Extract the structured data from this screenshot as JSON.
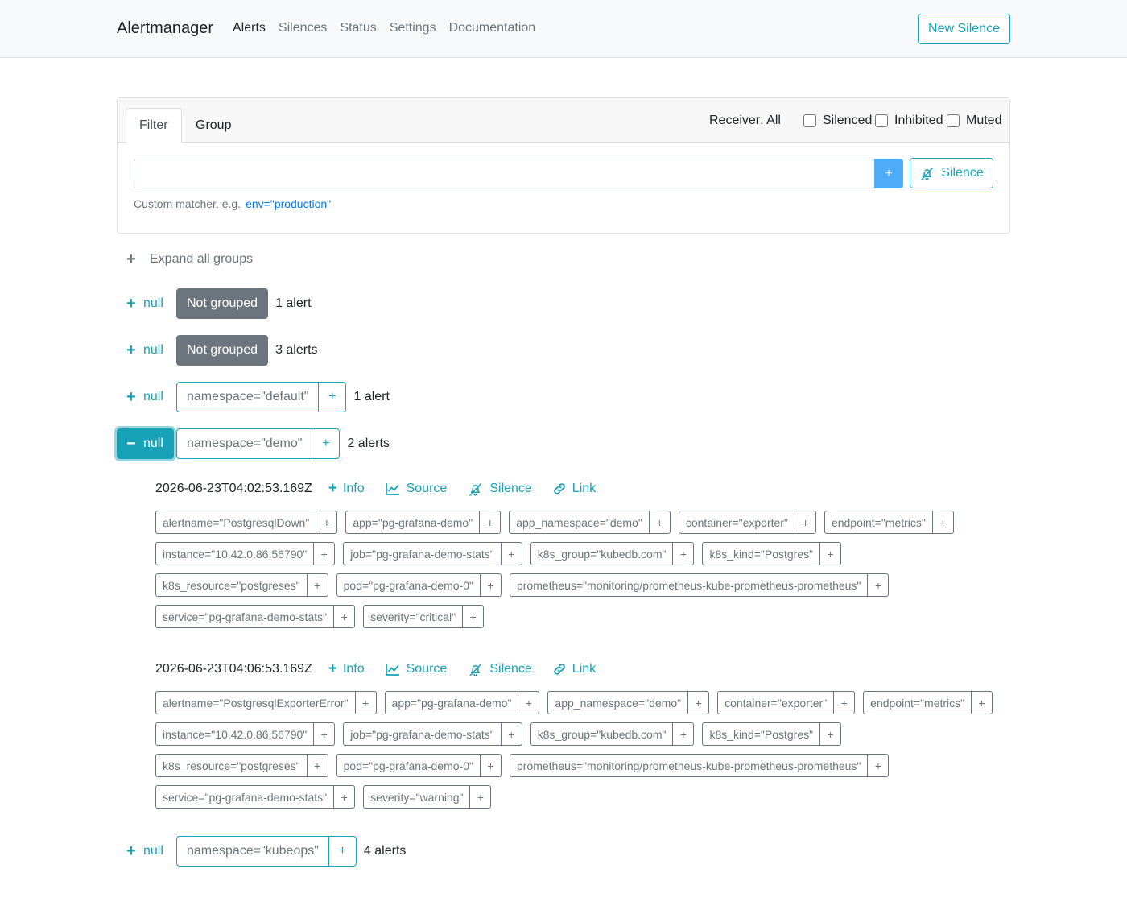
{
  "nav": {
    "brand": "Alertmanager",
    "links": [
      "Alerts",
      "Silences",
      "Status",
      "Settings",
      "Documentation"
    ],
    "new_silence": "New Silence"
  },
  "filter_card": {
    "tabs": [
      "Filter",
      "Group"
    ],
    "receiver": "Receiver: All",
    "checkboxes": [
      "Silenced",
      "Inhibited",
      "Muted"
    ],
    "input_value": "",
    "add_button": "+",
    "silence_button": "Silence",
    "hint": "Custom matcher, e.g.",
    "hint_example": "env=\"production\""
  },
  "expand_all": "Expand all groups",
  "groups": [
    {
      "toggle": "null",
      "symbol": "+",
      "badge": "Not grouped",
      "count": "1 alert"
    },
    {
      "toggle": "null",
      "symbol": "+",
      "badge": "Not grouped",
      "count": "3 alerts"
    },
    {
      "toggle": "null",
      "symbol": "+",
      "label": "namespace=\"default\"",
      "label_add": "+",
      "count": "1 alert"
    },
    {
      "toggle": "null",
      "symbol": "−",
      "label": "namespace=\"demo\"",
      "label_add": "+",
      "count": "2 alerts"
    },
    {
      "toggle": "null",
      "symbol": "+",
      "label": "namespace=\"kubeops\"",
      "label_add": "+",
      "count": "4 alerts"
    }
  ],
  "alert_actions": {
    "info": "Info",
    "source": "Source",
    "silence": "Silence",
    "link": "Link"
  },
  "alerts": [
    {
      "timestamp": "2026-06-23T04:02:53.169Z",
      "label_rows": [
        [
          "alertname=\"PostgresqlDown\"",
          "app=\"pg-grafana-demo\"",
          "app_namespace=\"demo\"",
          "container=\"exporter\"",
          "endpoint=\"metrics\""
        ],
        [
          "instance=\"10.42.0.86:56790\"",
          "job=\"pg-grafana-demo-stats\"",
          "k8s_group=\"kubedb.com\"",
          "k8s_kind=\"Postgres\""
        ],
        [
          "k8s_resource=\"postgreses\"",
          "pod=\"pg-grafana-demo-0\"",
          "prometheus=\"monitoring/prometheus-kube-prometheus-prometheus\""
        ],
        [
          "service=\"pg-grafana-demo-stats\"",
          "severity=\"critical\""
        ]
      ]
    },
    {
      "timestamp": "2026-06-23T04:06:53.169Z",
      "label_rows": [
        [
          "alertname=\"PostgresqlExporterError\"",
          "app=\"pg-grafana-demo\"",
          "app_namespace=\"demo\"",
          "container=\"exporter\"",
          "endpoint=\"metrics\""
        ],
        [
          "instance=\"10.42.0.86:56790\"",
          "job=\"pg-grafana-demo-stats\"",
          "k8s_group=\"kubedb.com\"",
          "k8s_kind=\"Postgres\""
        ],
        [
          "k8s_resource=\"postgreses\"",
          "pod=\"pg-grafana-demo-0\"",
          "prometheus=\"monitoring/prometheus-kube-prometheus-prometheus\""
        ],
        [
          "service=\"pg-grafana-demo-stats\"",
          "severity=\"warning\""
        ]
      ]
    }
  ],
  "chip_add": "+",
  "colors": {
    "accent": "#17a2b8",
    "muted": "#6c757d",
    "add_button": "#4dabf7"
  }
}
